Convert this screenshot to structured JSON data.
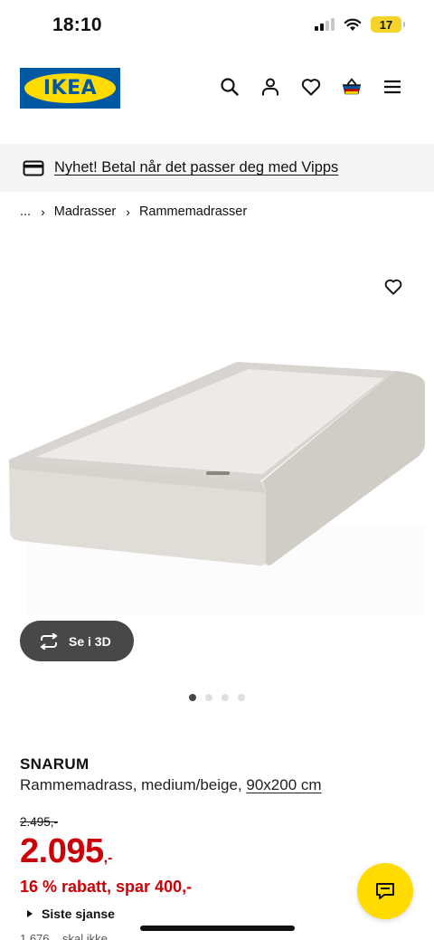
{
  "status_bar": {
    "time": "18:10",
    "battery": "17"
  },
  "header": {
    "logo_text": "IKEA",
    "icons": [
      "search-icon",
      "profile-icon",
      "heart-icon",
      "basket-icon",
      "menu-icon"
    ]
  },
  "promo": {
    "text": "Nyhet! Betal når det passer deg med Vipps",
    "icon": "card-icon"
  },
  "breadcrumb": {
    "ellipsis": "...",
    "items": [
      "Madrasser",
      "Rammemadrasser"
    ]
  },
  "gallery": {
    "button_3d_label": "Se i 3D",
    "dot_count": 4,
    "active_index": 0
  },
  "product": {
    "name": "SNARUM",
    "description": "Rammemadrass, medium/beige,",
    "size_link": "90x200 cm",
    "old_price": "2.495,-",
    "price_int": "2.095",
    "price_dec": ",-",
    "discount": "16 % rabatt, spar 400,-",
    "last_chance": "Siste sjanse",
    "partial_text": "1.676... skal ikke..."
  },
  "colors": {
    "ikea_blue": "#0058a3",
    "ikea_yellow": "#ffdb00",
    "price_red": "#cc0008"
  }
}
